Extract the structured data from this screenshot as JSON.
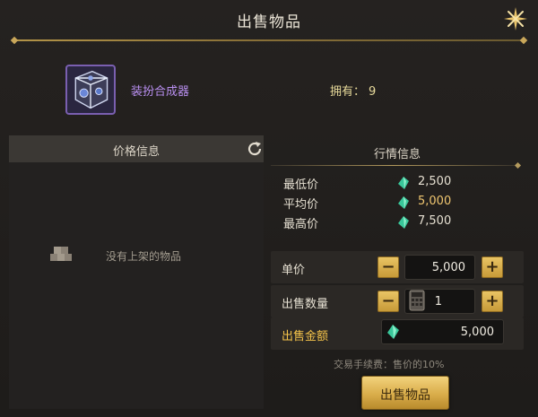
{
  "dialog": {
    "title": "出售物品"
  },
  "item": {
    "name": "装扮合成器",
    "owned_label": "拥有：",
    "owned_count": "9"
  },
  "left_panel": {
    "header": "价格信息",
    "empty_text": "没有上架的物品"
  },
  "market": {
    "title": "行情信息",
    "rows": [
      {
        "label": "最低价",
        "value": "2,500"
      },
      {
        "label": "平均价",
        "value": "5,000"
      },
      {
        "label": "最高价",
        "value": "7,500"
      }
    ]
  },
  "form": {
    "unit_price_label": "单价",
    "unit_price": "5,000",
    "quantity_label": "出售数量",
    "quantity": "1",
    "total_label": "出售金额",
    "total": "5,000",
    "minus": "−",
    "plus": "+"
  },
  "fee_note": "交易手续费：售价的10%",
  "sell_button": "出售物品",
  "colors": {
    "gold_accent": "#f5c44a",
    "item_name": "#b98ff0",
    "avg_price": "#f0c670"
  },
  "icons": [
    "close-icon",
    "refresh-icon",
    "empty-box-icon",
    "gem-icon",
    "calculator-icon"
  ]
}
